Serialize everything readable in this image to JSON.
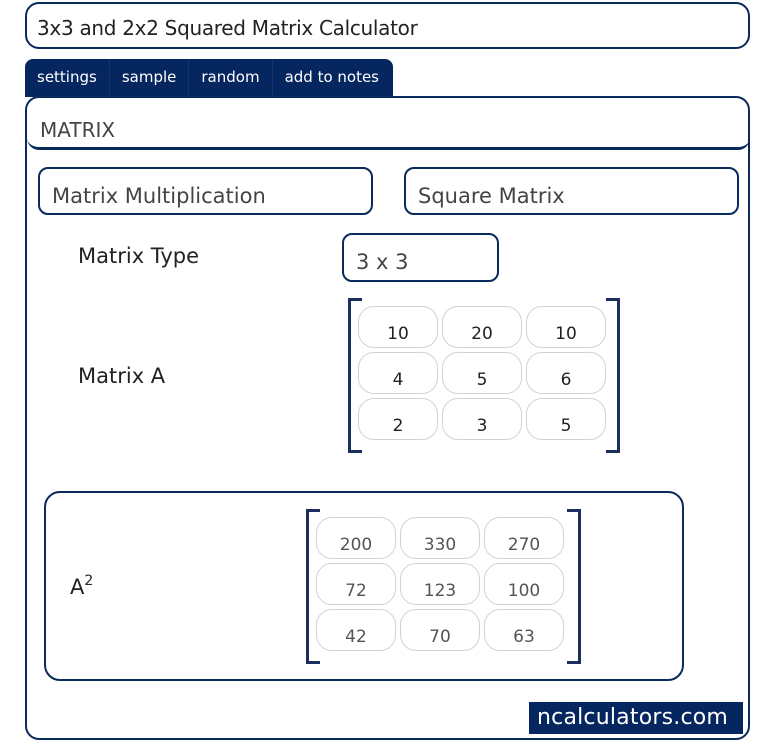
{
  "title": "3x3 and 2x2 Squared Matrix Calculator",
  "tabs": [
    {
      "label": "settings"
    },
    {
      "label": "sample"
    },
    {
      "label": "random"
    },
    {
      "label": "add to notes"
    }
  ],
  "section": {
    "header": "MATRIX",
    "operation_select": "Matrix Multiplication",
    "matrix_kind_select": "Square Matrix"
  },
  "form": {
    "matrix_type_label": "Matrix Type",
    "matrix_type_value": "3 x 3",
    "matrix_a_label": "Matrix A",
    "matrix_a": [
      [
        "10",
        "20",
        "10"
      ],
      [
        "4",
        "5",
        "6"
      ],
      [
        "2",
        "3",
        "5"
      ]
    ]
  },
  "result": {
    "label_base": "A",
    "label_exponent": "2",
    "matrix": [
      [
        "200",
        "330",
        "270"
      ],
      [
        "72",
        "123",
        "100"
      ],
      [
        "42",
        "70",
        "63"
      ]
    ]
  },
  "brand": "ncalculators.com",
  "colors": {
    "primary": "#062660",
    "border": "#0b2a5c",
    "cell_border": "#cfd3d8"
  }
}
